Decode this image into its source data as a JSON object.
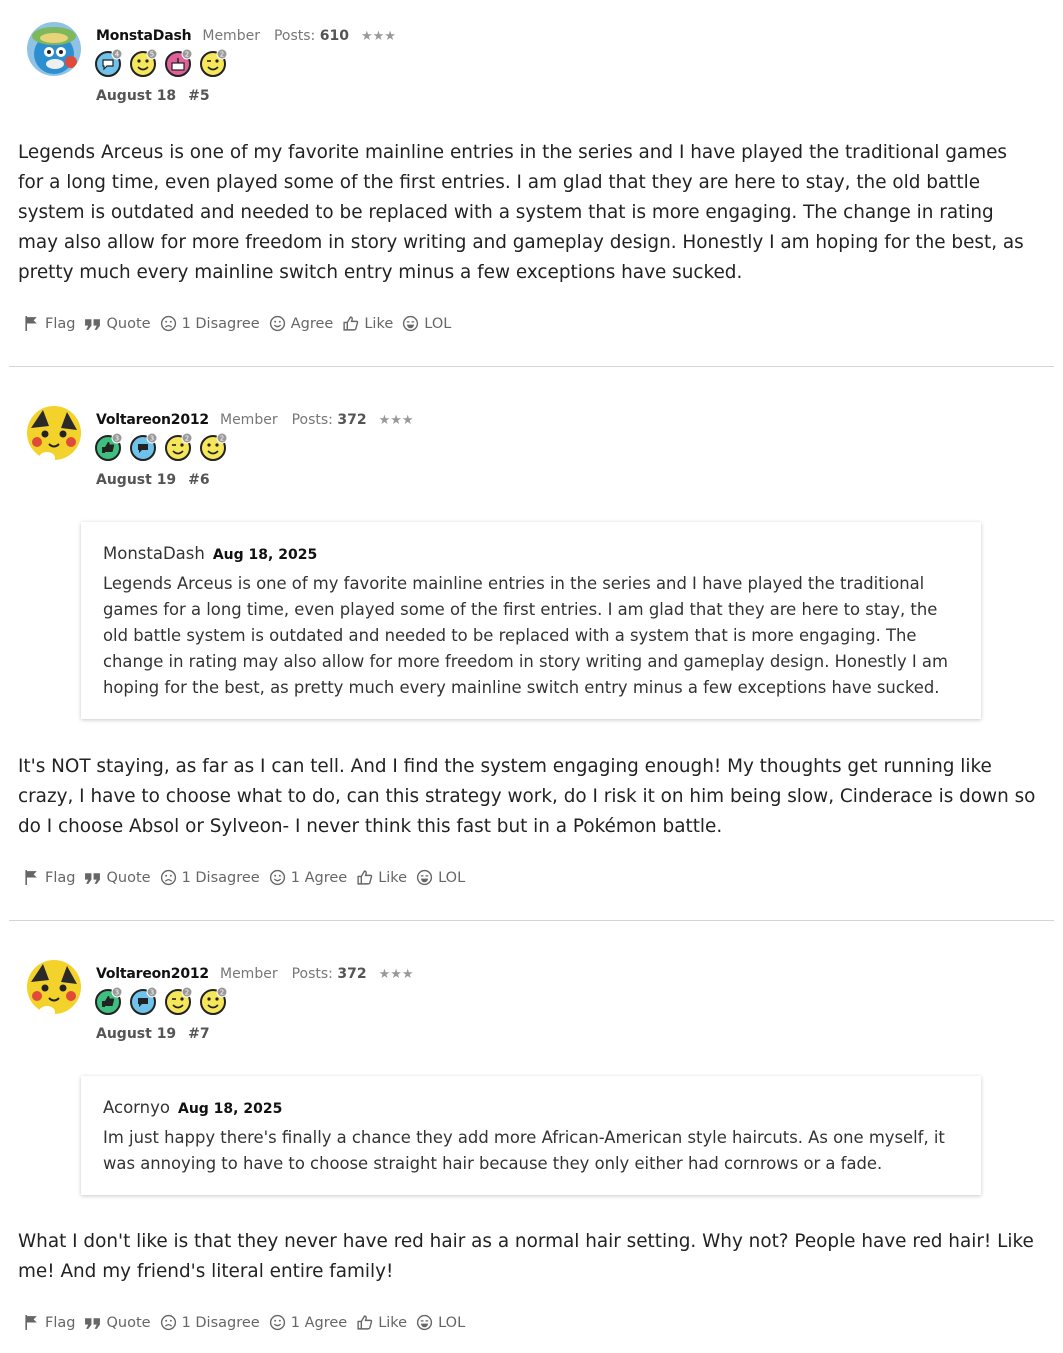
{
  "posts": [
    {
      "username": "MonstaDash",
      "role": "Member",
      "posts_label": "Posts:",
      "posts_count": "610",
      "stars": "★★★",
      "badge_counts": [
        "4",
        "5",
        "2",
        "2"
      ],
      "date": "August 18",
      "number": "#5",
      "body": "Legends Arceus is one of my favorite mainline entries in the series and I have played the traditional games for a long time, even played some of the first entries. I am glad that they are here to stay, the old battle system is outdated and needed to be replaced with a system that is more engaging. The change in rating may also allow for more freedom in story writing and gameplay design. Honestly I am hoping for the best, as pretty much every mainline switch entry minus a few exceptions have sucked.",
      "actions": {
        "flag": "Flag",
        "quote": "Quote",
        "disagree": "1 Disagree",
        "agree": "Agree",
        "like": "Like",
        "lol": "LOL"
      }
    },
    {
      "username": "Voltareon2012",
      "role": "Member",
      "posts_label": "Posts:",
      "posts_count": "372",
      "stars": "★★★",
      "badge_counts": [
        "3",
        "3",
        "2",
        "2"
      ],
      "date": "August 19",
      "number": "#6",
      "quote": {
        "author": "MonstaDash",
        "date": "Aug 18, 2025",
        "text": "Legends Arceus is one of my favorite mainline entries in the series and I have played the traditional games for a long time, even played some of the first entries. I am glad that they are here to stay, the old battle system is outdated and needed to be replaced with a system that is more engaging. The change in rating may also allow for more freedom in story writing and gameplay design. Honestly I am hoping for the best, as pretty much every mainline switch entry minus a few exceptions have sucked."
      },
      "body": "It's NOT staying, as far as I can tell. And I find the system engaging enough! My thoughts get running like crazy, I have to choose what to do, can this strategy work, do I risk it on him being slow, Cinderace is down so do I choose Absol or Sylveon- I never think this fast but in a Pokémon battle.",
      "actions": {
        "flag": "Flag",
        "quote": "Quote",
        "disagree": "1 Disagree",
        "agree": "1 Agree",
        "like": "Like",
        "lol": "LOL"
      }
    },
    {
      "username": "Voltareon2012",
      "role": "Member",
      "posts_label": "Posts:",
      "posts_count": "372",
      "stars": "★★★",
      "badge_counts": [
        "3",
        "3",
        "2",
        "2"
      ],
      "date": "August 19",
      "number": "#7",
      "quote": {
        "author": "Acornyo",
        "date": "Aug 18, 2025",
        "text": "Im just happy there's finally a chance they add more African-American style haircuts. As one myself, it was annoying to have to choose straight hair because they only either had cornrows or a fade."
      },
      "body": "What I don't like is that they never have red hair as a normal hair setting. Why not? People have red hair! Like me! And my friend's literal entire family!",
      "actions": {
        "flag": "Flag",
        "quote": "Quote",
        "disagree": "1 Disagree",
        "agree": "1 Agree",
        "like": "Like",
        "lol": "LOL"
      }
    }
  ],
  "colors": {
    "badge_blue": "#6fc3ea",
    "badge_yellow": "#f5e65a",
    "badge_pink": "#e0609a",
    "badge_green": "#3fbf7f",
    "avatar_yellow": "#f4d22c"
  }
}
